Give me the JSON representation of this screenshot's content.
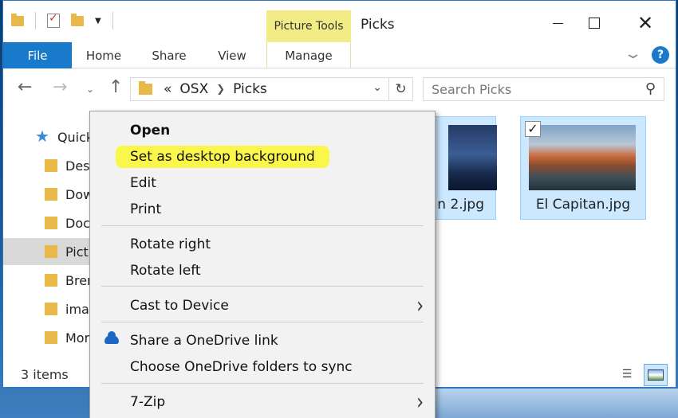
{
  "window": {
    "title": "Picks",
    "picture_tools_label": "Picture Tools",
    "tabs": [
      "File",
      "Home",
      "Share",
      "View",
      "Manage"
    ]
  },
  "address": {
    "overflow": "«",
    "path": [
      "OSX",
      "Picks"
    ]
  },
  "search": {
    "placeholder": "Search Picks"
  },
  "sidebar": {
    "items": [
      "Quick",
      "Des",
      "Dow",
      "Doc",
      "Pictu",
      "Bren",
      "ima",
      "Mor"
    ]
  },
  "files": [
    {
      "name": "n 2.jpg",
      "selected": true,
      "checked": false
    },
    {
      "name": "El Capitan.jpg",
      "selected": true,
      "checked": true
    }
  ],
  "status": {
    "count": "3 items"
  },
  "context_menu": {
    "open": "Open",
    "set_bg": "Set as desktop background",
    "edit": "Edit",
    "print": "Print",
    "rotate_right": "Rotate right",
    "rotate_left": "Rotate left",
    "cast": "Cast to Device",
    "onedrive_share": "Share a OneDrive link",
    "onedrive_sync": "Choose OneDrive folders to sync",
    "zip": "7-Zip"
  },
  "colors": {
    "accent": "#1979ca",
    "picture_tools": "#f3eb86",
    "highlight": "#fbf74a",
    "selection": "#cce8ff"
  },
  "icons": {
    "quick_access": "star-icon",
    "folder": "folder-icon",
    "search": "search-icon",
    "refresh": "refresh-icon",
    "onedrive": "cloud-icon"
  }
}
